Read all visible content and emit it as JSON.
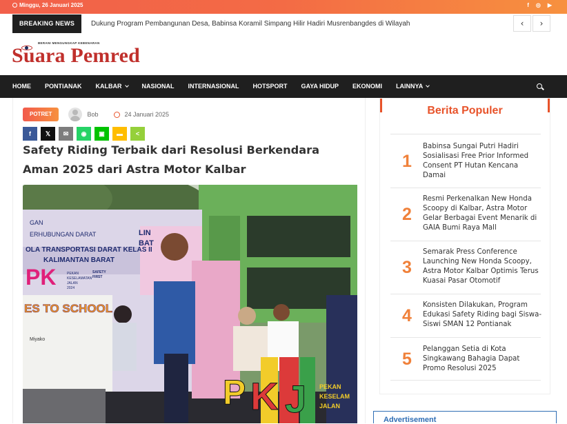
{
  "topbar": {
    "date": "Minggu, 26 Januari 2025",
    "social": [
      "f",
      "◎",
      "▶"
    ],
    "colors": {
      "gradient_start": "#f2604a",
      "gradient_end": "#f7913f"
    }
  },
  "breaking": {
    "label": "BREAKING NEWS",
    "headline": "Dukung Program Pembangunan Desa, Babinsa Koramil Simpang Hilir Hadiri Musrenbangdes di Wilayah",
    "prev": "‹",
    "next": "›"
  },
  "logo": {
    "tagline": "BERANI MENGUNGKAP KEBENARAN",
    "name": "Suara Pemred",
    "color": "#c0302c"
  },
  "nav": {
    "items": [
      {
        "label": "HOME"
      },
      {
        "label": "PONTIANAK"
      },
      {
        "label": "KALBAR",
        "dropdown": true
      },
      {
        "label": "NASIONAL"
      },
      {
        "label": "INTERNASIONAL"
      },
      {
        "label": "HOTSPORT"
      },
      {
        "label": "GAYA HIDUP"
      },
      {
        "label": "EKONOMI"
      },
      {
        "label": "LAINNYA",
        "dropdown": true
      }
    ],
    "search_icon": "search-icon"
  },
  "article": {
    "category": "POTRET",
    "author": "Bob",
    "date": "24 Januari 2025",
    "share": [
      {
        "icon": "facebook-icon",
        "glyph": "f",
        "color": "#3b5998"
      },
      {
        "icon": "x-icon",
        "glyph": "𝕏",
        "color": "#111111"
      },
      {
        "icon": "email-icon",
        "glyph": "✉",
        "color": "#7d7d7d"
      },
      {
        "icon": "whatsapp-icon",
        "glyph": "◉",
        "color": "#25d366"
      },
      {
        "icon": "line-icon",
        "glyph": "▣",
        "color": "#00c300"
      },
      {
        "icon": "sms-icon",
        "glyph": "▬",
        "color": "#ffbd00"
      },
      {
        "icon": "sharethis-icon",
        "glyph": "<",
        "color": "#95d03a"
      }
    ],
    "title": "Safety Riding Terbaik dari Resolusi Berkendara Aman 2025 dari Astra Motor Kalbar",
    "photo": {
      "banner_lines": [
        "GAN",
        "ERHUBUNGAN DARAT",
        "OLA TRANSPORTASI DARAT KELAS II",
        "KALIMANTAN BARAT"
      ],
      "banner_word": "PK",
      "banner_sub": [
        "PEKAN",
        "KESELAMATAN",
        "JALAN",
        "2024"
      ],
      "banner_small": [
        "SAFETY",
        "FIRST"
      ],
      "school_text": "ES TO SCHOOL",
      "lin_text": [
        "LIN",
        "BAT"
      ],
      "brand": "Miyako",
      "stage_letters": [
        "P",
        "K",
        "J"
      ],
      "right_banner": [
        "PEKAN",
        "KESELAM",
        "JALAN"
      ]
    }
  },
  "sidebar": {
    "title": "Berita Populer",
    "items": [
      {
        "rank": "1",
        "title": "Babinsa Sungai Putri Hadiri Sosialisasi Free Prior Informed Consent PT Hutan Kencana Damai"
      },
      {
        "rank": "2",
        "title": "Resmi Perkenalkan New Honda Scoopy di Kalbar, Astra Motor Gelar Berbagai Event Menarik di GAIA Bumi Raya Mall"
      },
      {
        "rank": "3",
        "title": "Semarak Press Conference Launching New Honda Scoopy, Astra Motor Kalbar Optimis Terus Kuasai Pasar Otomotif"
      },
      {
        "rank": "4",
        "title": "Konsisten Dilakukan, Program Edukasi Safety Riding bagi Siswa-Siswi SMAN 12 Pontianak"
      },
      {
        "rank": "5",
        "title": "Pelanggan Setia di Kota Singkawang Bahagia Dapat Promo Resolusi 2025"
      }
    ],
    "accent": "#e8532a",
    "number_color": "#f0813a"
  },
  "advert": {
    "label": "Advertisement"
  }
}
